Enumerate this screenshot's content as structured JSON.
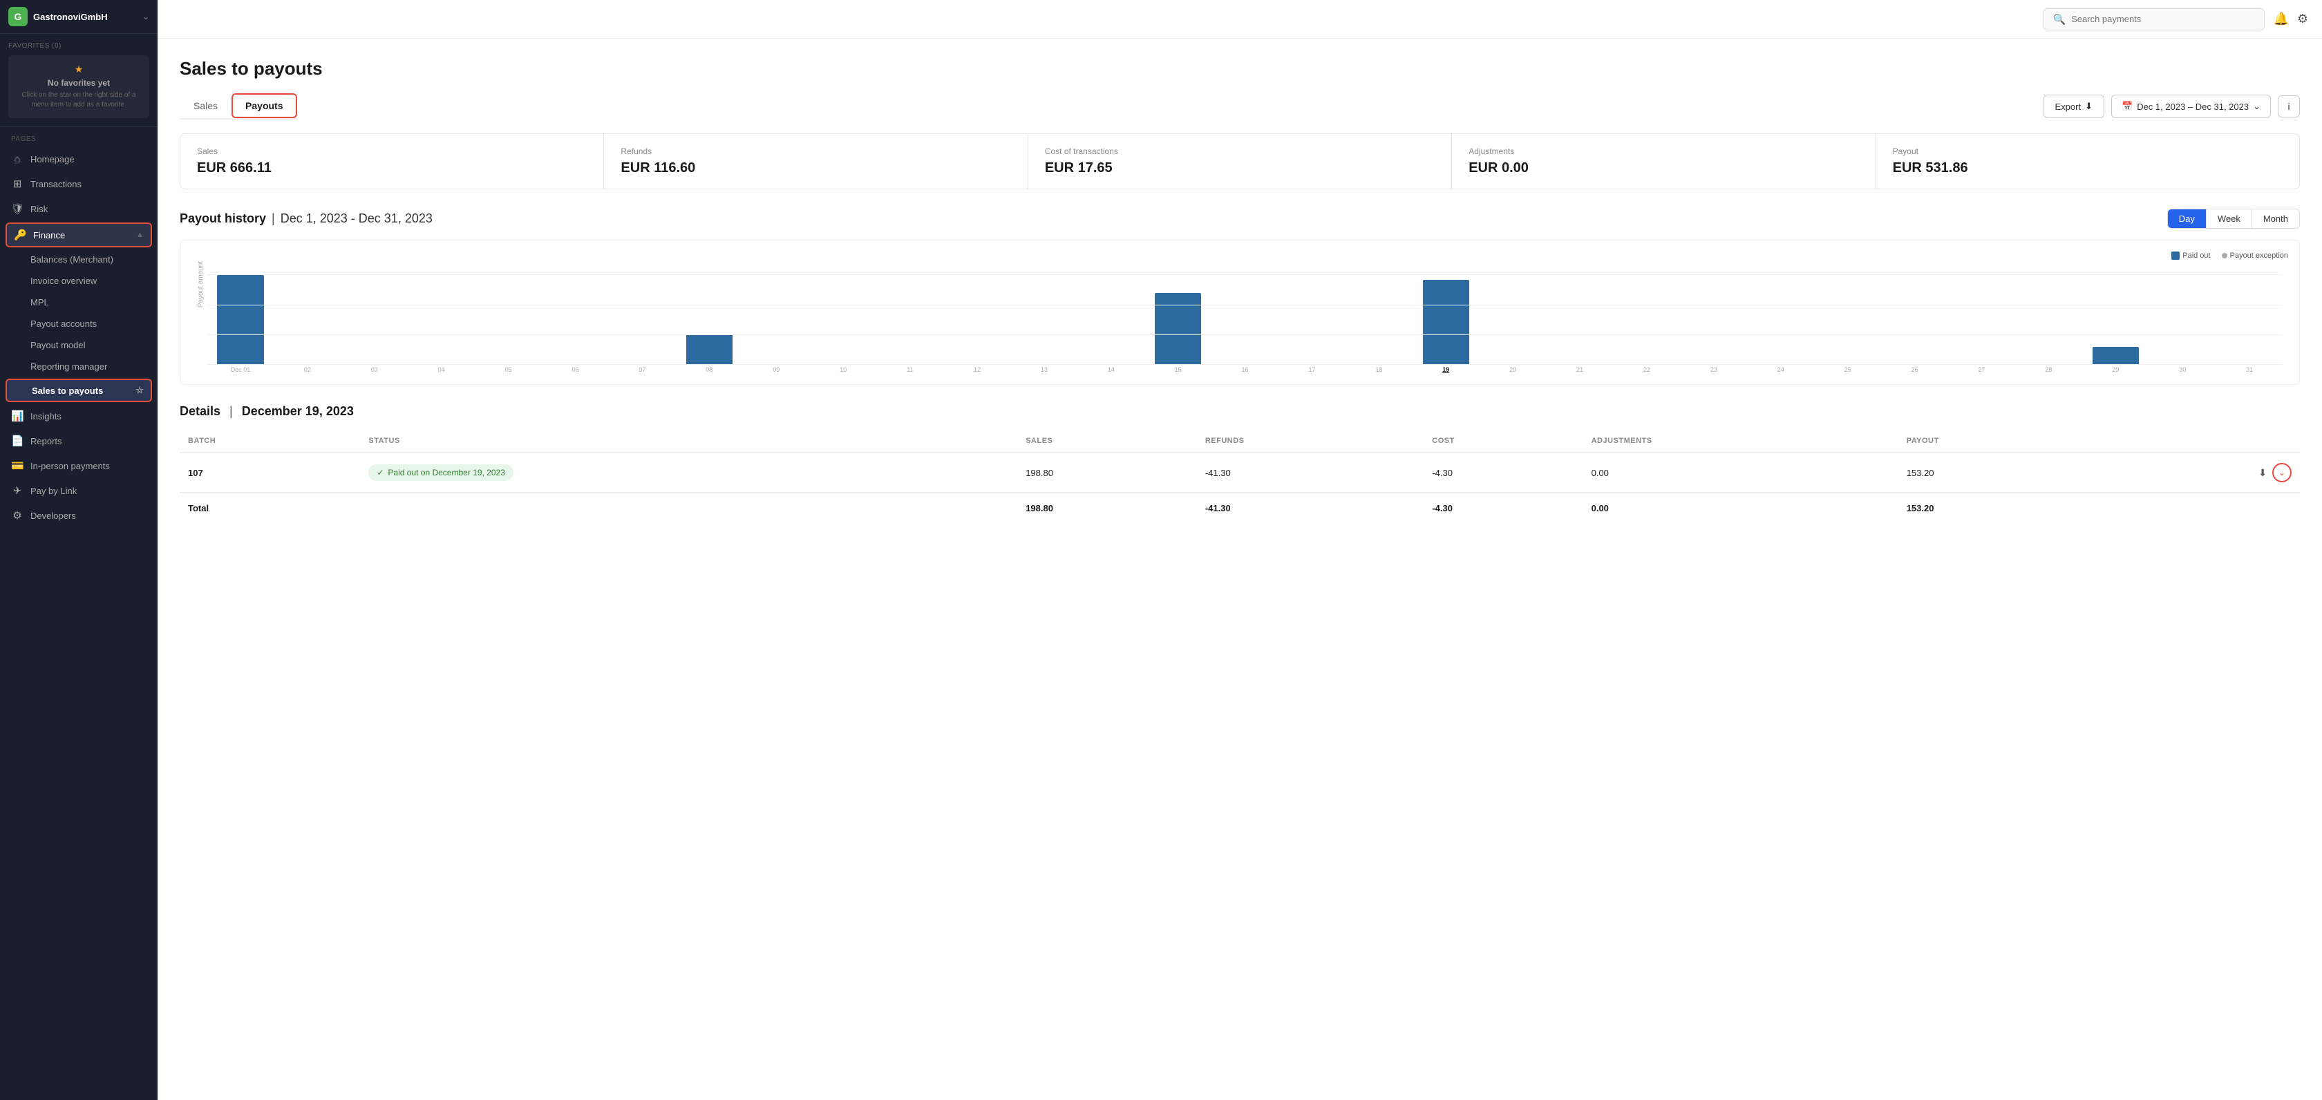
{
  "app": {
    "brand": "GastronoviGmbH",
    "logo_letter": "G"
  },
  "topbar": {
    "search_placeholder": "Search payments"
  },
  "favorites": {
    "label": "FAVORITES (0)",
    "no_fav": "No favorites yet",
    "hint": "Click on the star on the right side of a menu item to add as a favorite."
  },
  "pages_label": "PAGES",
  "sidebar": {
    "items": [
      {
        "id": "homepage",
        "label": "Homepage",
        "icon": "🏠"
      },
      {
        "id": "transactions",
        "label": "Transactions",
        "icon": "⊞"
      },
      {
        "id": "risk",
        "label": "Risk",
        "icon": "🛡"
      },
      {
        "id": "finance",
        "label": "Finance",
        "icon": "🔑"
      },
      {
        "id": "insights",
        "label": "Insights",
        "icon": "📊"
      },
      {
        "id": "reports",
        "label": "Reports",
        "icon": "📄"
      },
      {
        "id": "in-person-payments",
        "label": "In-person payments",
        "icon": "💳"
      },
      {
        "id": "pay-by-link",
        "label": "Pay by Link",
        "icon": "✈"
      },
      {
        "id": "developers",
        "label": "Developers",
        "icon": "⚙"
      }
    ],
    "finance_subitems": [
      {
        "id": "balances",
        "label": "Balances (Merchant)"
      },
      {
        "id": "invoice-overview",
        "label": "Invoice overview"
      },
      {
        "id": "mpl",
        "label": "MPL"
      },
      {
        "id": "payout-accounts",
        "label": "Payout accounts"
      },
      {
        "id": "payout-model",
        "label": "Payout model"
      },
      {
        "id": "reporting-manager",
        "label": "Reporting manager"
      },
      {
        "id": "sales-to-payouts",
        "label": "Sales to payouts"
      }
    ]
  },
  "page": {
    "title": "Sales to payouts"
  },
  "tabs": {
    "items": [
      {
        "id": "sales",
        "label": "Sales"
      },
      {
        "id": "payouts",
        "label": "Payouts"
      }
    ],
    "active": "payouts"
  },
  "toolbar": {
    "export_label": "Export",
    "date_range": "Dec 1, 2023 – Dec 31, 2023",
    "info_label": "i"
  },
  "summary": {
    "cards": [
      {
        "id": "sales",
        "label": "Sales",
        "value": "EUR 666.11"
      },
      {
        "id": "refunds",
        "label": "Refunds",
        "value": "EUR 116.60"
      },
      {
        "id": "cost-of-transactions",
        "label": "Cost of transactions",
        "value": "EUR 17.65"
      },
      {
        "id": "adjustments",
        "label": "Adjustments",
        "value": "EUR 0.00"
      },
      {
        "id": "payout",
        "label": "Payout",
        "value": "EUR 531.86"
      }
    ]
  },
  "payout_history": {
    "title": "Payout history",
    "date_range": "Dec 1, 2023 - Dec 31, 2023",
    "view_buttons": [
      {
        "id": "day",
        "label": "Day",
        "active": true
      },
      {
        "id": "week",
        "label": "Week",
        "active": false
      },
      {
        "id": "month",
        "label": "Month",
        "active": false
      }
    ],
    "legend": [
      {
        "id": "paid-out",
        "label": "Paid out"
      },
      {
        "id": "payout-exception",
        "label": "Payout exception"
      }
    ],
    "y_axis": [
      "150",
      "100",
      "50",
      "0"
    ],
    "bars": [
      {
        "label": "Dec 01",
        "height_pct": 100,
        "value": 160
      },
      {
        "label": "02",
        "height_pct": 0,
        "value": 0
      },
      {
        "label": "03",
        "height_pct": 0,
        "value": 0
      },
      {
        "label": "04",
        "height_pct": 0,
        "value": 0
      },
      {
        "label": "05",
        "height_pct": 0,
        "value": 0
      },
      {
        "label": "06",
        "height_pct": 0,
        "value": 0
      },
      {
        "label": "07",
        "height_pct": 0,
        "value": 0
      },
      {
        "label": "08",
        "height_pct": 34,
        "value": 55
      },
      {
        "label": "09",
        "height_pct": 0,
        "value": 0
      },
      {
        "label": "10",
        "height_pct": 0,
        "value": 0
      },
      {
        "label": "11",
        "height_pct": 0,
        "value": 0
      },
      {
        "label": "12",
        "height_pct": 0,
        "value": 0
      },
      {
        "label": "13",
        "height_pct": 0,
        "value": 0
      },
      {
        "label": "14",
        "height_pct": 0,
        "value": 0
      },
      {
        "label": "15",
        "height_pct": 80,
        "value": 128
      },
      {
        "label": "16",
        "height_pct": 0,
        "value": 0
      },
      {
        "label": "17",
        "height_pct": 0,
        "value": 0
      },
      {
        "label": "18",
        "height_pct": 0,
        "value": 0
      },
      {
        "label": "19",
        "height_pct": 95,
        "value": 153,
        "highlighted": true
      },
      {
        "label": "20",
        "height_pct": 0,
        "value": 0
      },
      {
        "label": "21",
        "height_pct": 0,
        "value": 0
      },
      {
        "label": "22",
        "height_pct": 0,
        "value": 0
      },
      {
        "label": "23",
        "height_pct": 0,
        "value": 0
      },
      {
        "label": "24",
        "height_pct": 0,
        "value": 0
      },
      {
        "label": "25",
        "height_pct": 0,
        "value": 0
      },
      {
        "label": "26",
        "height_pct": 0,
        "value": 0
      },
      {
        "label": "27",
        "height_pct": 0,
        "value": 0
      },
      {
        "label": "28",
        "height_pct": 0,
        "value": 0
      },
      {
        "label": "29",
        "height_pct": 20,
        "value": 32
      },
      {
        "label": "30",
        "height_pct": 0,
        "value": 0
      },
      {
        "label": "31",
        "height_pct": 0,
        "value": 0
      }
    ]
  },
  "details": {
    "title": "Details",
    "date": "December 19, 2023",
    "columns": [
      "BATCH",
      "STATUS",
      "SALES",
      "REFUNDS",
      "COST",
      "ADJUSTMENTS",
      "PAYOUT"
    ],
    "rows": [
      {
        "batch": "107",
        "status": "Paid out on December 19, 2023",
        "sales": "198.80",
        "refunds": "-41.30",
        "cost": "-4.30",
        "adjustments": "0.00",
        "payout": "153.20"
      }
    ],
    "total_row": {
      "label": "Total",
      "sales": "198.80",
      "refunds": "-41.30",
      "cost": "-4.30",
      "adjustments": "0.00",
      "payout": "153.20"
    }
  }
}
